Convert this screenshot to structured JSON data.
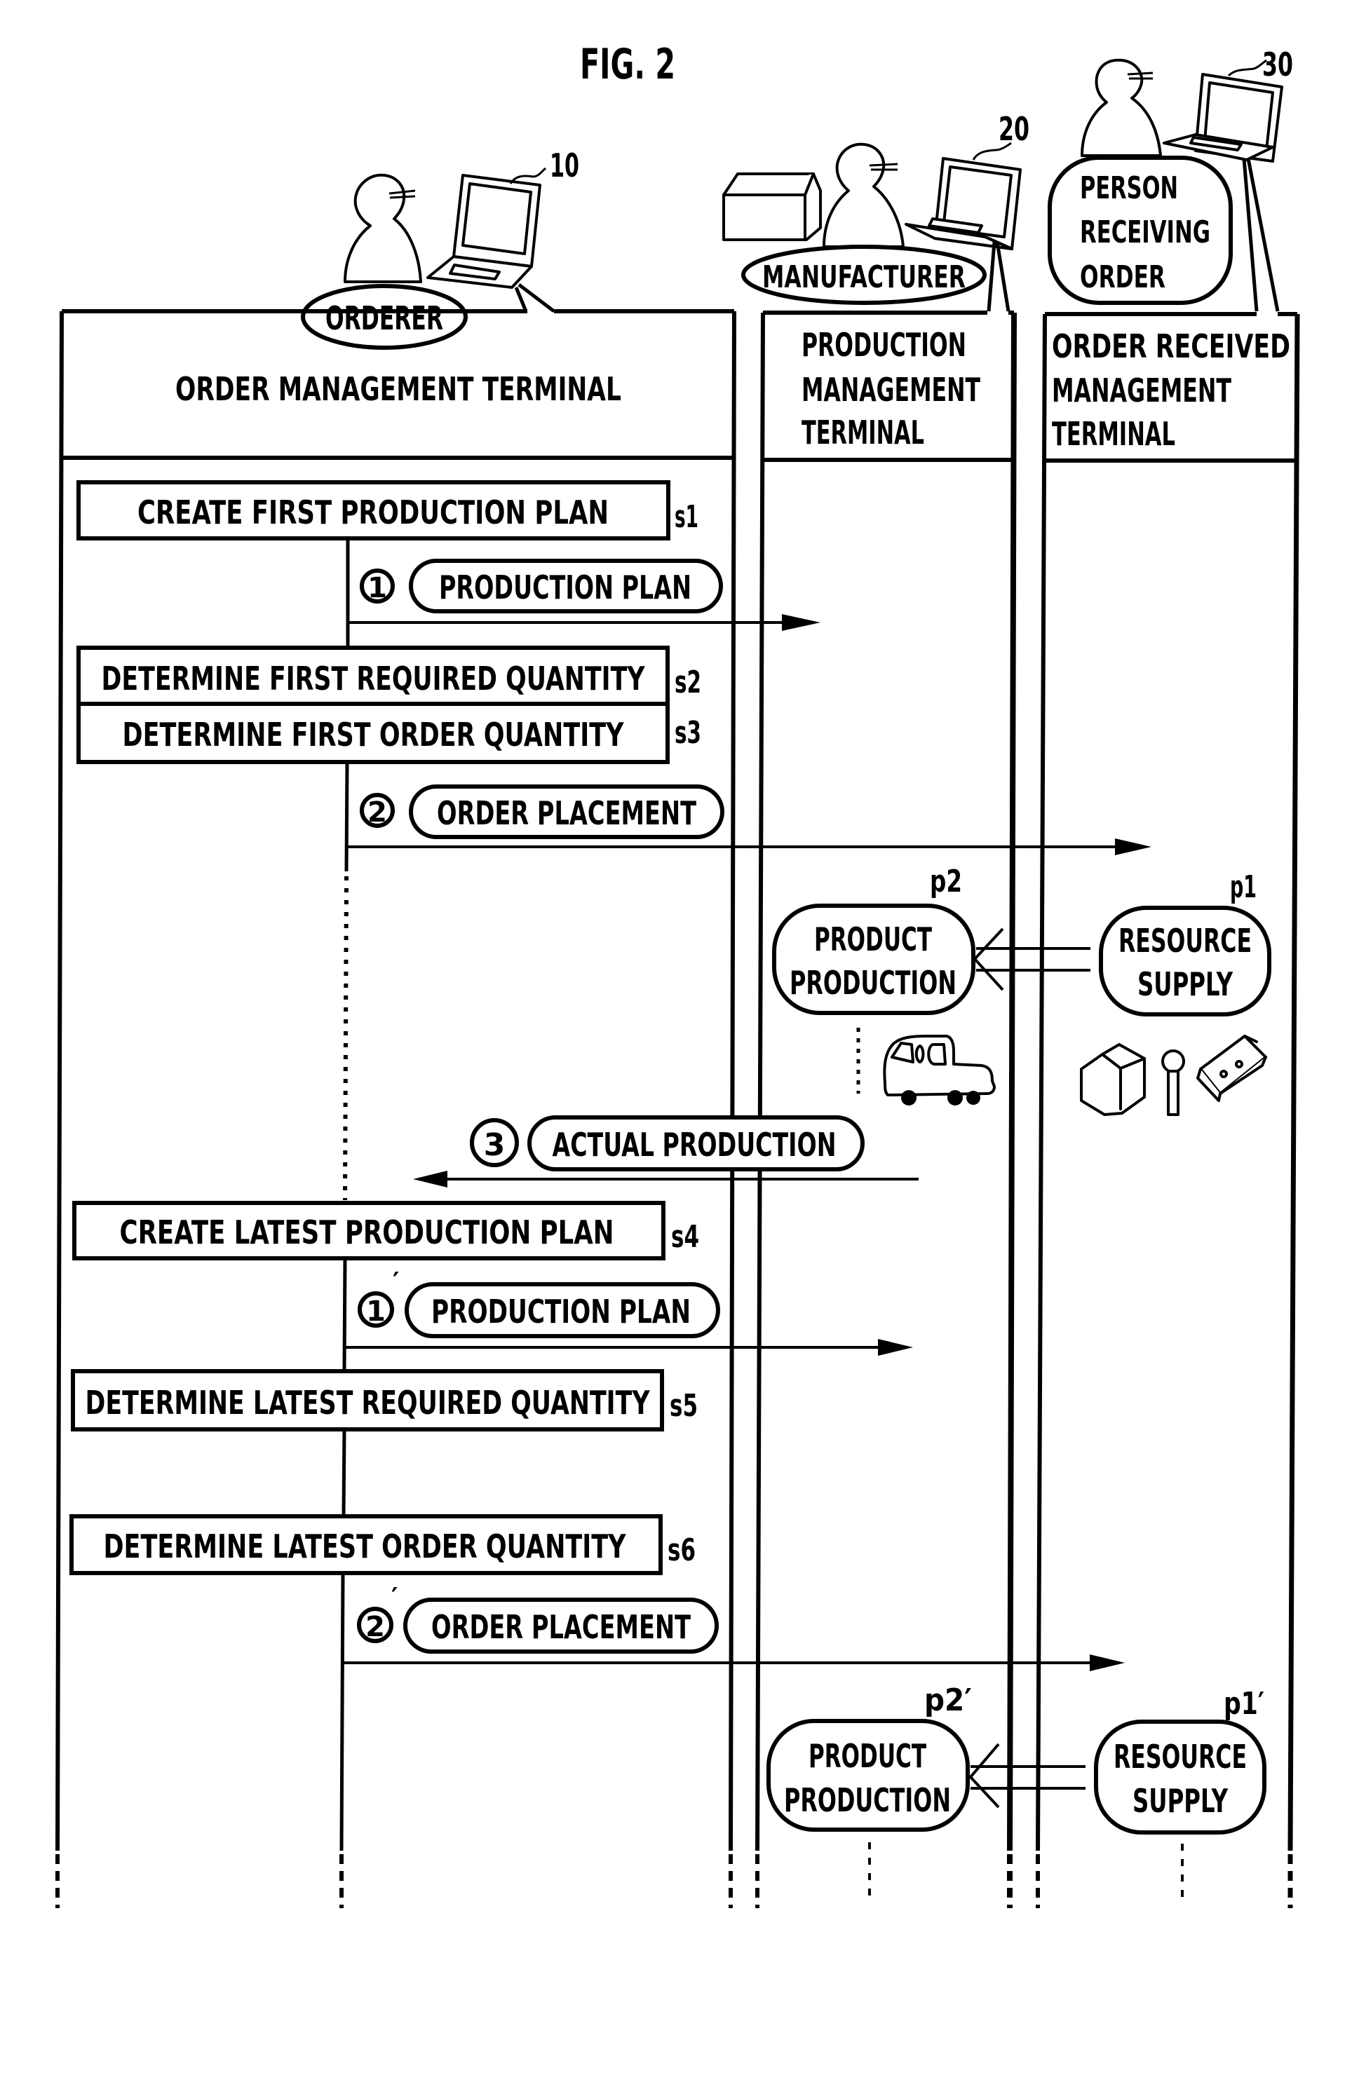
{
  "figure": {
    "title": "FIG. 2"
  },
  "actors": {
    "orderer": {
      "label": "ORDERER",
      "ref": "10"
    },
    "manufacturer": {
      "label": "MANUFACTURER",
      "ref": "20"
    },
    "receiver": {
      "label_lines": [
        "PERSON",
        "RECEIVING",
        "ORDER"
      ],
      "ref": "30"
    }
  },
  "lanes": {
    "order_management": {
      "title": "ORDER  MANAGEMENT  TERMINAL"
    },
    "production_management": {
      "title_lines": [
        "PRODUCTION",
        "MANAGEMENT",
        "TERMINAL"
      ]
    },
    "order_received_management": {
      "title_lines": [
        "ORDER  RECEIVED",
        "MANAGEMENT",
        "TERMINAL"
      ]
    }
  },
  "steps": [
    {
      "id": "s1",
      "label": "CREATE  FIRST  PRODUCTION  PLAN"
    },
    {
      "id": "s2",
      "label": "DETERMINE  FIRST  REQUIRED  QUANTITY"
    },
    {
      "id": "s3",
      "label": "DETERMINE  FIRST  ORDER  QUANTITY"
    },
    {
      "id": "s4",
      "label": "CREATE  LATEST  PRODUCTION  PLAN"
    },
    {
      "id": "s5",
      "label": "DETERMINE  LATEST  REQUIRED  QUANTITY"
    },
    {
      "id": "s6",
      "label": "DETERMINE  LATEST  ORDER  QUANTITY"
    }
  ],
  "messages": [
    {
      "num": "1",
      "prime": "",
      "label": "PRODUCTION  PLAN",
      "direction": "to-production"
    },
    {
      "num": "2",
      "prime": "",
      "label": "ORDER  PLACEMENT",
      "direction": "to-order-received"
    },
    {
      "num": "3",
      "prime": "",
      "label": "ACTUAL  PRODUCTION",
      "direction": "to-order-management"
    },
    {
      "num": "1",
      "prime": "′",
      "label": "PRODUCTION  PLAN",
      "direction": "to-production"
    },
    {
      "num": "2",
      "prime": "′",
      "label": "ORDER  PLACEMENT",
      "direction": "to-order-received"
    }
  ],
  "processes": [
    {
      "id": "p2",
      "label_lines": [
        "PRODUCT",
        "PRODUCTION"
      ]
    },
    {
      "id": "p1",
      "label_lines": [
        "RESOURCE",
        "SUPPLY"
      ]
    },
    {
      "id": "p2′",
      "label_lines": [
        "PRODUCT",
        "PRODUCTION"
      ]
    },
    {
      "id": "p1′",
      "label_lines": [
        "RESOURCE",
        "SUPPLY"
      ]
    }
  ],
  "colors": {
    "ink": "#000000",
    "paper": "#ffffff"
  }
}
